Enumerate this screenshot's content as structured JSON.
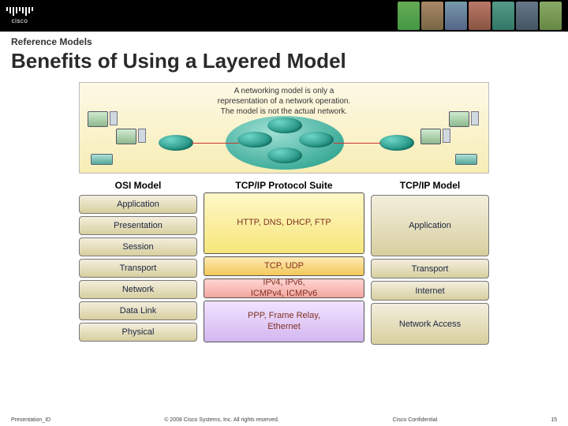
{
  "brand": "cisco",
  "subhead": "Reference Models",
  "title": "Benefits of Using a Layered Model",
  "scene_text_l1": "A networking model is only a",
  "scene_text_l2": "representation of a network operation.",
  "scene_text_l3": "The model is not the actual network.",
  "columns": {
    "osi_header": "OSI Model",
    "suite_header": "TCP/IP Protocol  Suite",
    "tcpip_header": "TCP/IP Model"
  },
  "osi_layers": [
    "Application",
    "Presentation",
    "Session",
    "Transport",
    "Network",
    "Data Link",
    "Physical"
  ],
  "suite_bands": {
    "app": "HTTP, DNS, DHCP, FTP",
    "transport": "TCP, UDP",
    "network": "IPv4, IPv6,\nICMPv4, ICMPv6",
    "link": "PPP, Frame Relay,\nEthernet"
  },
  "tcpip_layers": [
    "Application",
    "Transport",
    "Internet",
    "Network Access"
  ],
  "footer": {
    "left": "Presentation_ID",
    "center": "© 2008 Cisco Systems, Inc. All rights reserved.",
    "right": "Cisco Confidential",
    "page": "15"
  }
}
